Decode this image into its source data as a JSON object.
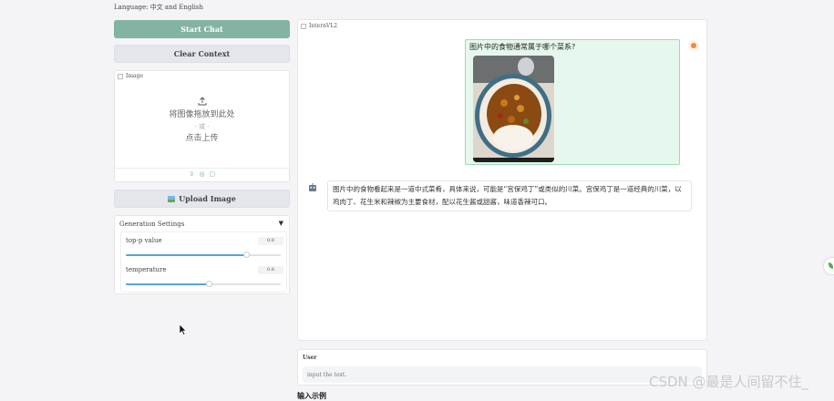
{
  "header": {
    "language": "Language: 中文 and English"
  },
  "left": {
    "start_chat": "Start Chat",
    "clear_context": "Clear Context",
    "image_panel": {
      "label": "Image",
      "drop_text": "将图像拖放到此处",
      "or_text": "- 或 -",
      "click_text": "点击上传"
    },
    "upload_image": "Upload Image",
    "generation": {
      "title": "Generation Settings",
      "top_p": {
        "label": "top-p value",
        "value": "0.8",
        "fraction": 0.78
      },
      "temperature": {
        "label": "temperature",
        "value": "0.8",
        "fraction": 0.54
      }
    }
  },
  "chat": {
    "label": "InternVL2",
    "user_message": "图片中的食物通常属于哪个菜系?",
    "bot_message": "图片中的食物看起来是一道中式菜肴，具体来说，可能是“宫保鸡丁”或类似的川菜。宫保鸡丁是一道经典的川菜，以鸡肉丁、花生米和辣椒为主要食材，配以花生酱或甜酱，味道香辣可口。"
  },
  "input": {
    "label": "User",
    "placeholder": "input the text."
  },
  "examples_heading": "输入示例",
  "watermark": "CSDN @最是人间留不住_",
  "colors": {
    "accent": "#83b3a2",
    "user_bubble": "#e6f8ed",
    "slider": "#5aa3d4"
  }
}
